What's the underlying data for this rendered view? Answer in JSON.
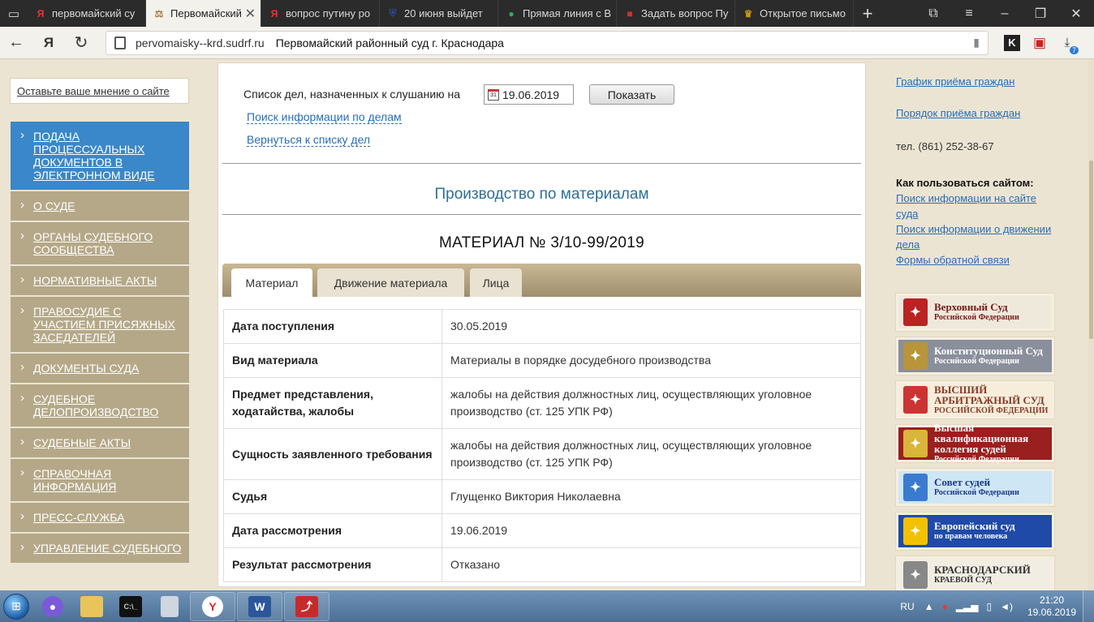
{
  "browser": {
    "tabs": [
      {
        "title": "первомайский су",
        "favicon": "Я",
        "color": "#e33"
      },
      {
        "title": "Первомайский",
        "favicon": "⚖",
        "color": "#a08040",
        "active": true
      },
      {
        "title": "вопрос путину ро",
        "favicon": "Я",
        "color": "#e33"
      },
      {
        "title": "20 июня выйдет",
        "favicon": "⛨",
        "color": "#2a4a9a"
      },
      {
        "title": "Прямая линия с В",
        "favicon": "●",
        "color": "#3a6"
      },
      {
        "title": "Задать вопрос Пу",
        "favicon": "■",
        "color": "#c33"
      },
      {
        "title": "Открытое письмо",
        "favicon": "♛",
        "color": "#c90"
      }
    ],
    "active_close": "✕",
    "url_domain": "pervomaisky--krd.sudrf.ru",
    "page_title": "Первомайский районный суд г. Краснодара",
    "download_badge": "7"
  },
  "sidebar": {
    "opinion_link": "Оставьте ваше мнение о сайте",
    "menu": [
      {
        "label": "Подача процессуальных документов в электронном виде",
        "active": true
      },
      {
        "label": "О суде"
      },
      {
        "label": "Органы судебного сообщества"
      },
      {
        "label": "Нормативные акты"
      },
      {
        "label": "Правосудие с участием присяжных заседателей"
      },
      {
        "label": "Документы суда"
      },
      {
        "label": "Судебное делопроизводство"
      },
      {
        "label": "Судебные акты"
      },
      {
        "label": "Справочная информация"
      },
      {
        "label": "Пресс-служба"
      },
      {
        "label": "Управление судебного"
      }
    ]
  },
  "main": {
    "list_label": "Список дел, назначенных к слушанию на",
    "date_value": "19.06.2019",
    "show_button": "Показать",
    "search_link": "Поиск информации по делам",
    "back_link": "Вернуться к списку дел",
    "section_title": "Производство по материалам",
    "material_title": "МАТЕРИАЛ № 3/10-99/2019",
    "tabs": [
      "Материал",
      "Движение материала",
      "Лица"
    ],
    "rows": [
      {
        "key": "Дата поступления",
        "value": "30.05.2019"
      },
      {
        "key": "Вид материала",
        "value": "Материалы в порядке досудебного производства"
      },
      {
        "key": "Предмет представления, ходатайства, жалобы",
        "value": "жалобы на действия должностных лиц, осуществляющих уголовное производство (ст. 125 УПК РФ)"
      },
      {
        "key": "Сущность заявленного требования",
        "value": "жалобы на действия должностных лиц, осуществляющих уголовное производство (ст. 125 УПК РФ)"
      },
      {
        "key": "Судья",
        "value": "Глущенко Виктория Николаевна"
      },
      {
        "key": "Дата рассмотрения",
        "value": "19.06.2019"
      },
      {
        "key": "Результат рассмотрения",
        "value": "Отказано"
      }
    ]
  },
  "right": {
    "link1": "График приёма граждан",
    "link2": "Порядок приёма граждан",
    "phone": "тел. (861) 252-38-67",
    "howto": "Как пользоваться сайтом:",
    "help_links": [
      "Поиск информации на сайте суда",
      "Поиск информации о движении дела",
      "Формы обратной связи"
    ],
    "banners": [
      {
        "title": "Верховный Суд",
        "sub": "Российской Федерации",
        "bg": "#efe9dc",
        "fg": "#7a1a1a",
        "emb": "#b22"
      },
      {
        "title": "Конституционный Суд",
        "sub": "Российской Федерации",
        "bg": "#8a8f9c",
        "fg": "#fff",
        "emb": "#b8953a"
      },
      {
        "title": "ВЫСШИЙ АРБИТРАЖНЫЙ СУД",
        "sub": "РОССИЙСКОЙ ФЕДЕРАЦИИ",
        "bg": "#f6eedb",
        "fg": "#8a3a2a",
        "emb": "#c33"
      },
      {
        "title": "Высшая квалификационная коллегия судей",
        "sub": "Российской Федерации",
        "bg": "#9a1f1f",
        "fg": "#fff",
        "emb": "#d9b53a"
      },
      {
        "title": "Совет судей",
        "sub": "Российской Федерации",
        "bg": "#cfe6f5",
        "fg": "#1a3a8a",
        "emb": "#3a7bd0"
      },
      {
        "title": "Европейский суд",
        "sub": "по правам человека",
        "bg": "#1f4aa8",
        "fg": "#fff",
        "emb": "#f2c200"
      },
      {
        "title": "КРАСНОДАРСКИЙ",
        "sub": "КРАЕВОЙ СУД",
        "bg": "#f2ede3",
        "fg": "#333",
        "emb": "#888"
      }
    ]
  },
  "taskbar": {
    "lang": "RU",
    "time": "21:20",
    "date": "19.06.2019"
  }
}
